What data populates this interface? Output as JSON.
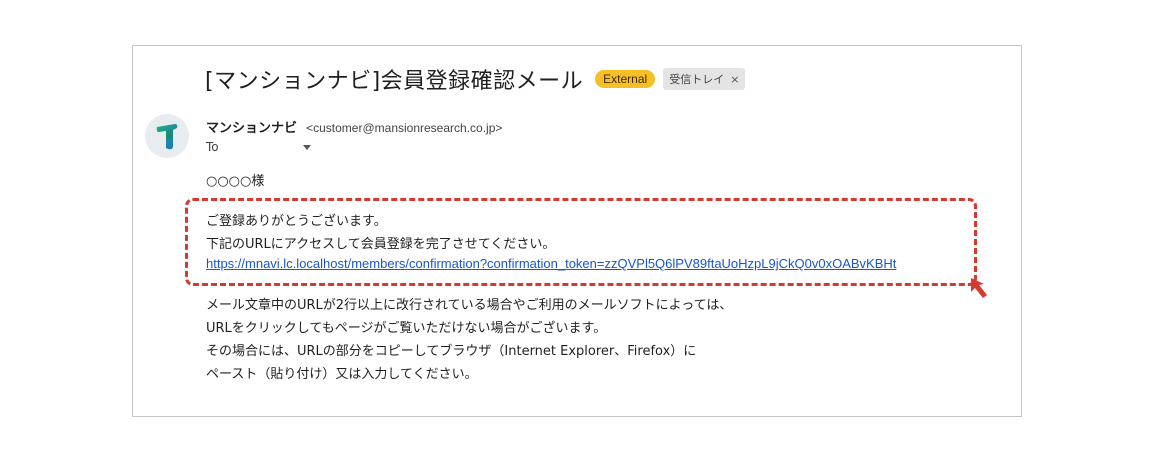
{
  "email": {
    "subject": "[マンションナビ]会員登録確認メール",
    "labels": {
      "external": "External",
      "inbox": "受信トレイ",
      "close": "×"
    },
    "sender": {
      "name": "マンションナビ",
      "email": "<customer@mansionresearch.co.jp>"
    },
    "to_label": "To",
    "greeting": "○○○○様",
    "body_highlight": {
      "line1": "ご登録ありがとうございます。",
      "line2": "下記のURLにアクセスして会員登録を完了させてください。",
      "link": "https://mnavi.lc.localhost/members/confirmation?confirmation_token=zzQVPl5Q6lPV89ftaUoHzpL9jCkQ0v0xOABvKBHt"
    },
    "body_note": [
      "メール文章中のURLが2行以上に改行されている場合やご利用のメールソフトによっては、",
      "URLをクリックしてもページがご覧いただけない場合がございます。",
      "その場合には、URLの部分をコピーしてブラウザ（Internet Explorer、Firefox）に",
      "ペースト（貼り付け）又は入力してください。"
    ]
  },
  "colors": {
    "external_badge": "#f6bf26",
    "highlight_border": "#d43a2f",
    "link": "#1a57c4",
    "avatar_gradient": [
      "#1aa37a",
      "#1b6fc4"
    ]
  },
  "icons": {
    "avatar": "mansion-navi-logo-icon",
    "arrow": "pointer-arrow-icon",
    "caret": "caret-down-icon"
  }
}
